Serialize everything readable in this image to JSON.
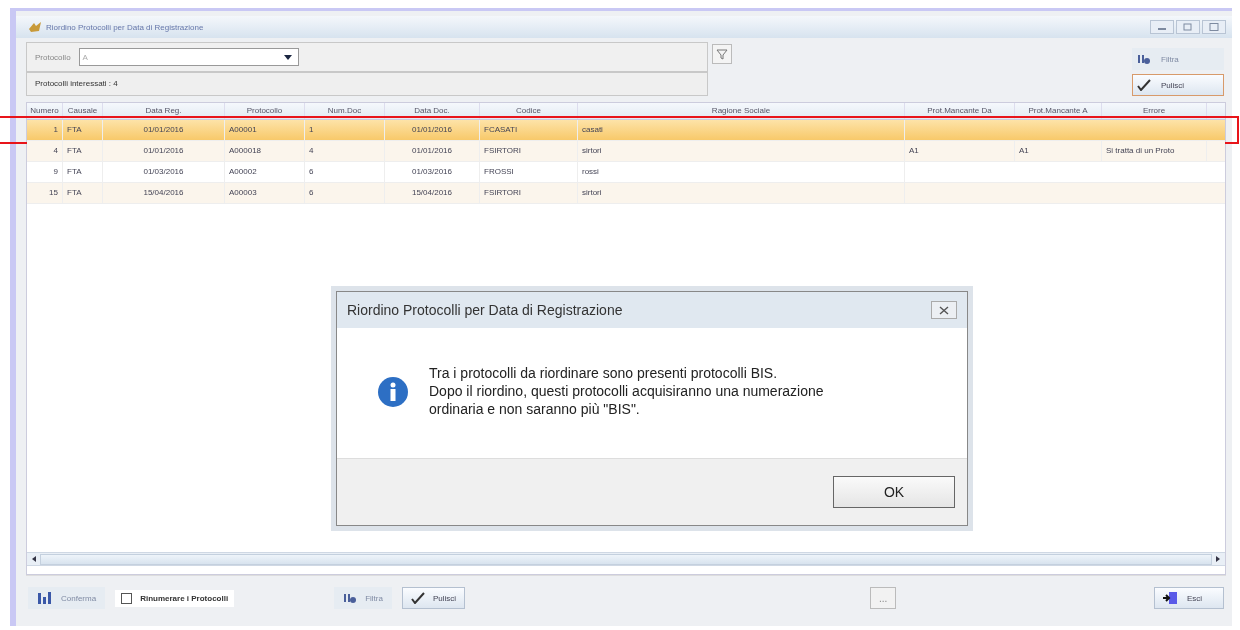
{
  "window": {
    "title": "Riordino Protocolli per Data di Registrazione"
  },
  "filter": {
    "label": "Protocollo",
    "value": "A",
    "count_text": "Protocolli interessati : 4"
  },
  "side_buttons": [
    {
      "kind": "filter",
      "label": "Filtra",
      "disabled": true
    },
    {
      "kind": "clear",
      "label": "Pulisci",
      "disabled": false
    }
  ],
  "table": {
    "columns": [
      "Numero",
      "Causale",
      "Data Reg.",
      "Protocollo",
      "Num.Doc",
      "Data Doc.",
      "Codice",
      "Ragione Sociale",
      "Prot.Mancante Da",
      "Prot.Mancante A",
      "Errore"
    ],
    "rows": [
      {
        "selected": true,
        "highlighted": true,
        "cells": [
          "1",
          "FTA",
          "01/01/2016",
          "A00001",
          "1",
          "01/01/2016",
          "FCASATI",
          "casati",
          "",
          "",
          ""
        ]
      },
      {
        "selected": false,
        "highlighted": false,
        "cells": [
          "4",
          "FTA",
          "01/01/2016",
          "A000018",
          "4",
          "01/01/2016",
          "FSIRTORI",
          "sirtori",
          "A1",
          "A1",
          "Si tratta di un Proto"
        ]
      },
      {
        "selected": false,
        "highlighted": false,
        "cells": [
          "9",
          "FTA",
          "01/03/2016",
          "A00002",
          "6",
          "01/03/2016",
          "FROSSI",
          "rossi",
          "",
          "",
          ""
        ]
      },
      {
        "selected": false,
        "highlighted": false,
        "cells": [
          "15",
          "FTA",
          "15/04/2016",
          "A00003",
          "6",
          "15/04/2016",
          "FSIRTORI",
          "sirtori",
          "",
          "",
          ""
        ]
      }
    ]
  },
  "bottom": {
    "confirm": {
      "label": "Conferma",
      "disabled": true
    },
    "renumber": {
      "label": "Rinumerare i Protocolli",
      "checked": false
    },
    "filter": {
      "label": "Filtra",
      "disabled": true
    },
    "clear": {
      "label": "Pulisci",
      "disabled": false
    },
    "more": {
      "label": "...",
      "disabled": true
    },
    "exit": {
      "label": "Esci",
      "disabled": false
    }
  },
  "dialog": {
    "title": "Riordino Protocolli per Data di Registrazione",
    "message": "Tra i protocolli da riordinare sono presenti protocolli BIS.\nDopo il riordino, questi protocolli acquisiranno una numerazione\nordinaria e non saranno più \"BIS\".",
    "button": "OK"
  }
}
